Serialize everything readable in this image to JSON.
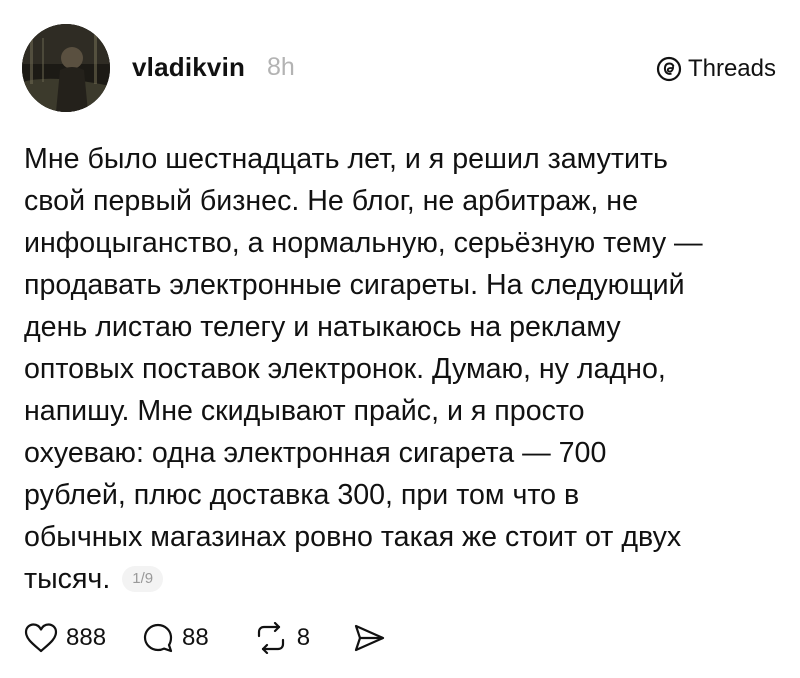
{
  "post": {
    "author": "vladikvin",
    "time_ago": "8h",
    "brand": "Threads",
    "lines": [
      "Мне было шестнадцать лет, и я решил замутить",
      "свой первый бизнес. Не блог, не арбитраж, не",
      "инфоцыганство, а нормальную, серьёзную тему —",
      "продавать электронные сигареты. На следующий",
      "день листаю телегу и натыкаюсь на рекламу",
      "оптовых поставок электронок. Думаю, ну ладно,",
      "напишу. Мне скидывают прайс, и я просто",
      "охуеваю: одна электронная сигарета — 700",
      "рублей, плюс доставка 300, при том что в",
      "обычных магазинах ровно такая же стоит от двух"
    ],
    "last_line": "тысяч.",
    "page_indicator": "1/9"
  },
  "actions": {
    "likes": "888",
    "replies": "88",
    "reposts": "8"
  },
  "icons": {
    "like": "heart-icon",
    "reply": "comment-bubble-icon",
    "repost": "repost-icon",
    "share": "send-icon",
    "brand": "threads-logo-icon"
  }
}
